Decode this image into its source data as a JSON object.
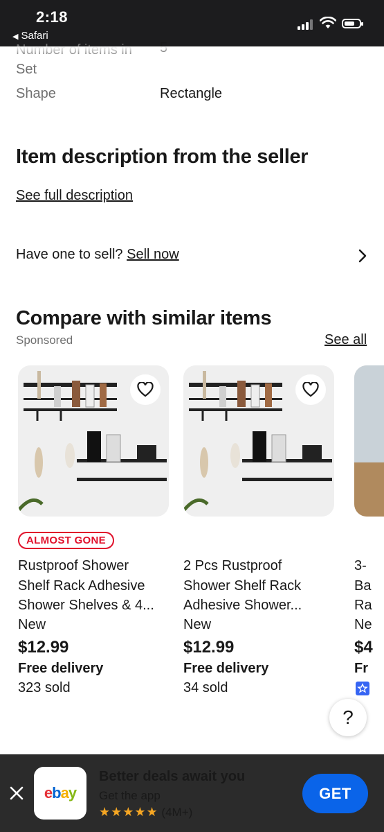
{
  "status_bar": {
    "time": "2:18",
    "back_app": "Safari"
  },
  "specs": [
    {
      "label": "Number of items in Set",
      "value": "5"
    },
    {
      "label": "Shape",
      "value": "Rectangle"
    }
  ],
  "description": {
    "heading": "Item description from the seller",
    "link": "See full description"
  },
  "sell": {
    "prompt": "Have one to sell?",
    "link": "Sell now"
  },
  "compare": {
    "heading": "Compare with similar items",
    "sponsored": "Sponsored",
    "see_all": "See all"
  },
  "cards": [
    {
      "badge": "ALMOST GONE",
      "title": "Rustproof Shower Shelf Rack Adhesive Shower Shelves & 4...",
      "condition": "New",
      "price": "$12.99",
      "delivery": "Free delivery",
      "sold": "323 sold"
    },
    {
      "title": "2 Pcs Rustproof Shower Shelf Rack Adhesive Shower...",
      "condition": "New",
      "price": "$12.99",
      "delivery": "Free delivery",
      "sold": "34 sold"
    },
    {
      "title_fragment": [
        "3-",
        "Ba",
        "Ra"
      ],
      "condition_fragment": "Ne",
      "price_fragment": "$4",
      "delivery_fragment": "Fr"
    }
  ],
  "help": {
    "label": "?"
  },
  "banner": {
    "title": "Better deals await you",
    "subtitle": "Get the app",
    "stars": "★★★★★",
    "rating_count": "(4M+)",
    "logo_text": [
      "e",
      "b",
      "a",
      "y"
    ],
    "get_label": "GET"
  },
  "colors": {
    "accent": "#0a64e9",
    "badge": "#e0102a",
    "banner_bg": "#2b2b2b",
    "star": "#f5a623"
  }
}
